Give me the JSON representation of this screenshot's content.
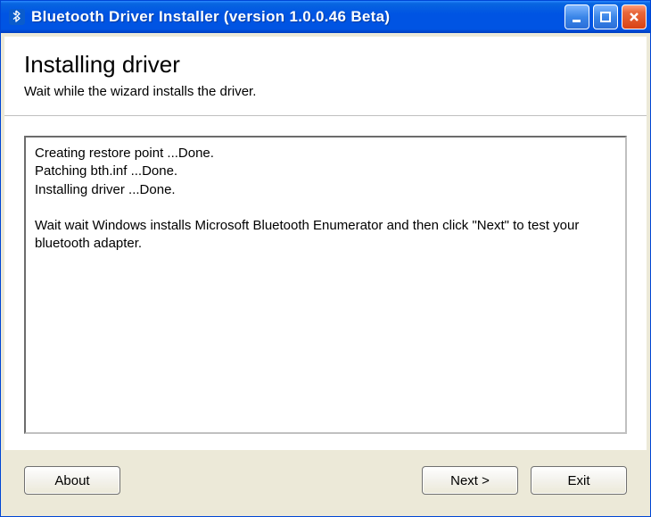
{
  "window": {
    "title": "Bluetooth Driver Installer (version 1.0.0.46 Beta)"
  },
  "header": {
    "title": "Installing driver",
    "subtitle": "Wait while the wizard installs the driver."
  },
  "log": {
    "text": "Creating restore point ...Done.\nPatching bth.inf ...Done.\nInstalling driver ...Done.\n\nWait wait Windows installs Microsoft Bluetooth Enumerator and then click \"Next\" to test your bluetooth adapter."
  },
  "buttons": {
    "about": "About",
    "next": "Next >",
    "exit": "Exit"
  }
}
